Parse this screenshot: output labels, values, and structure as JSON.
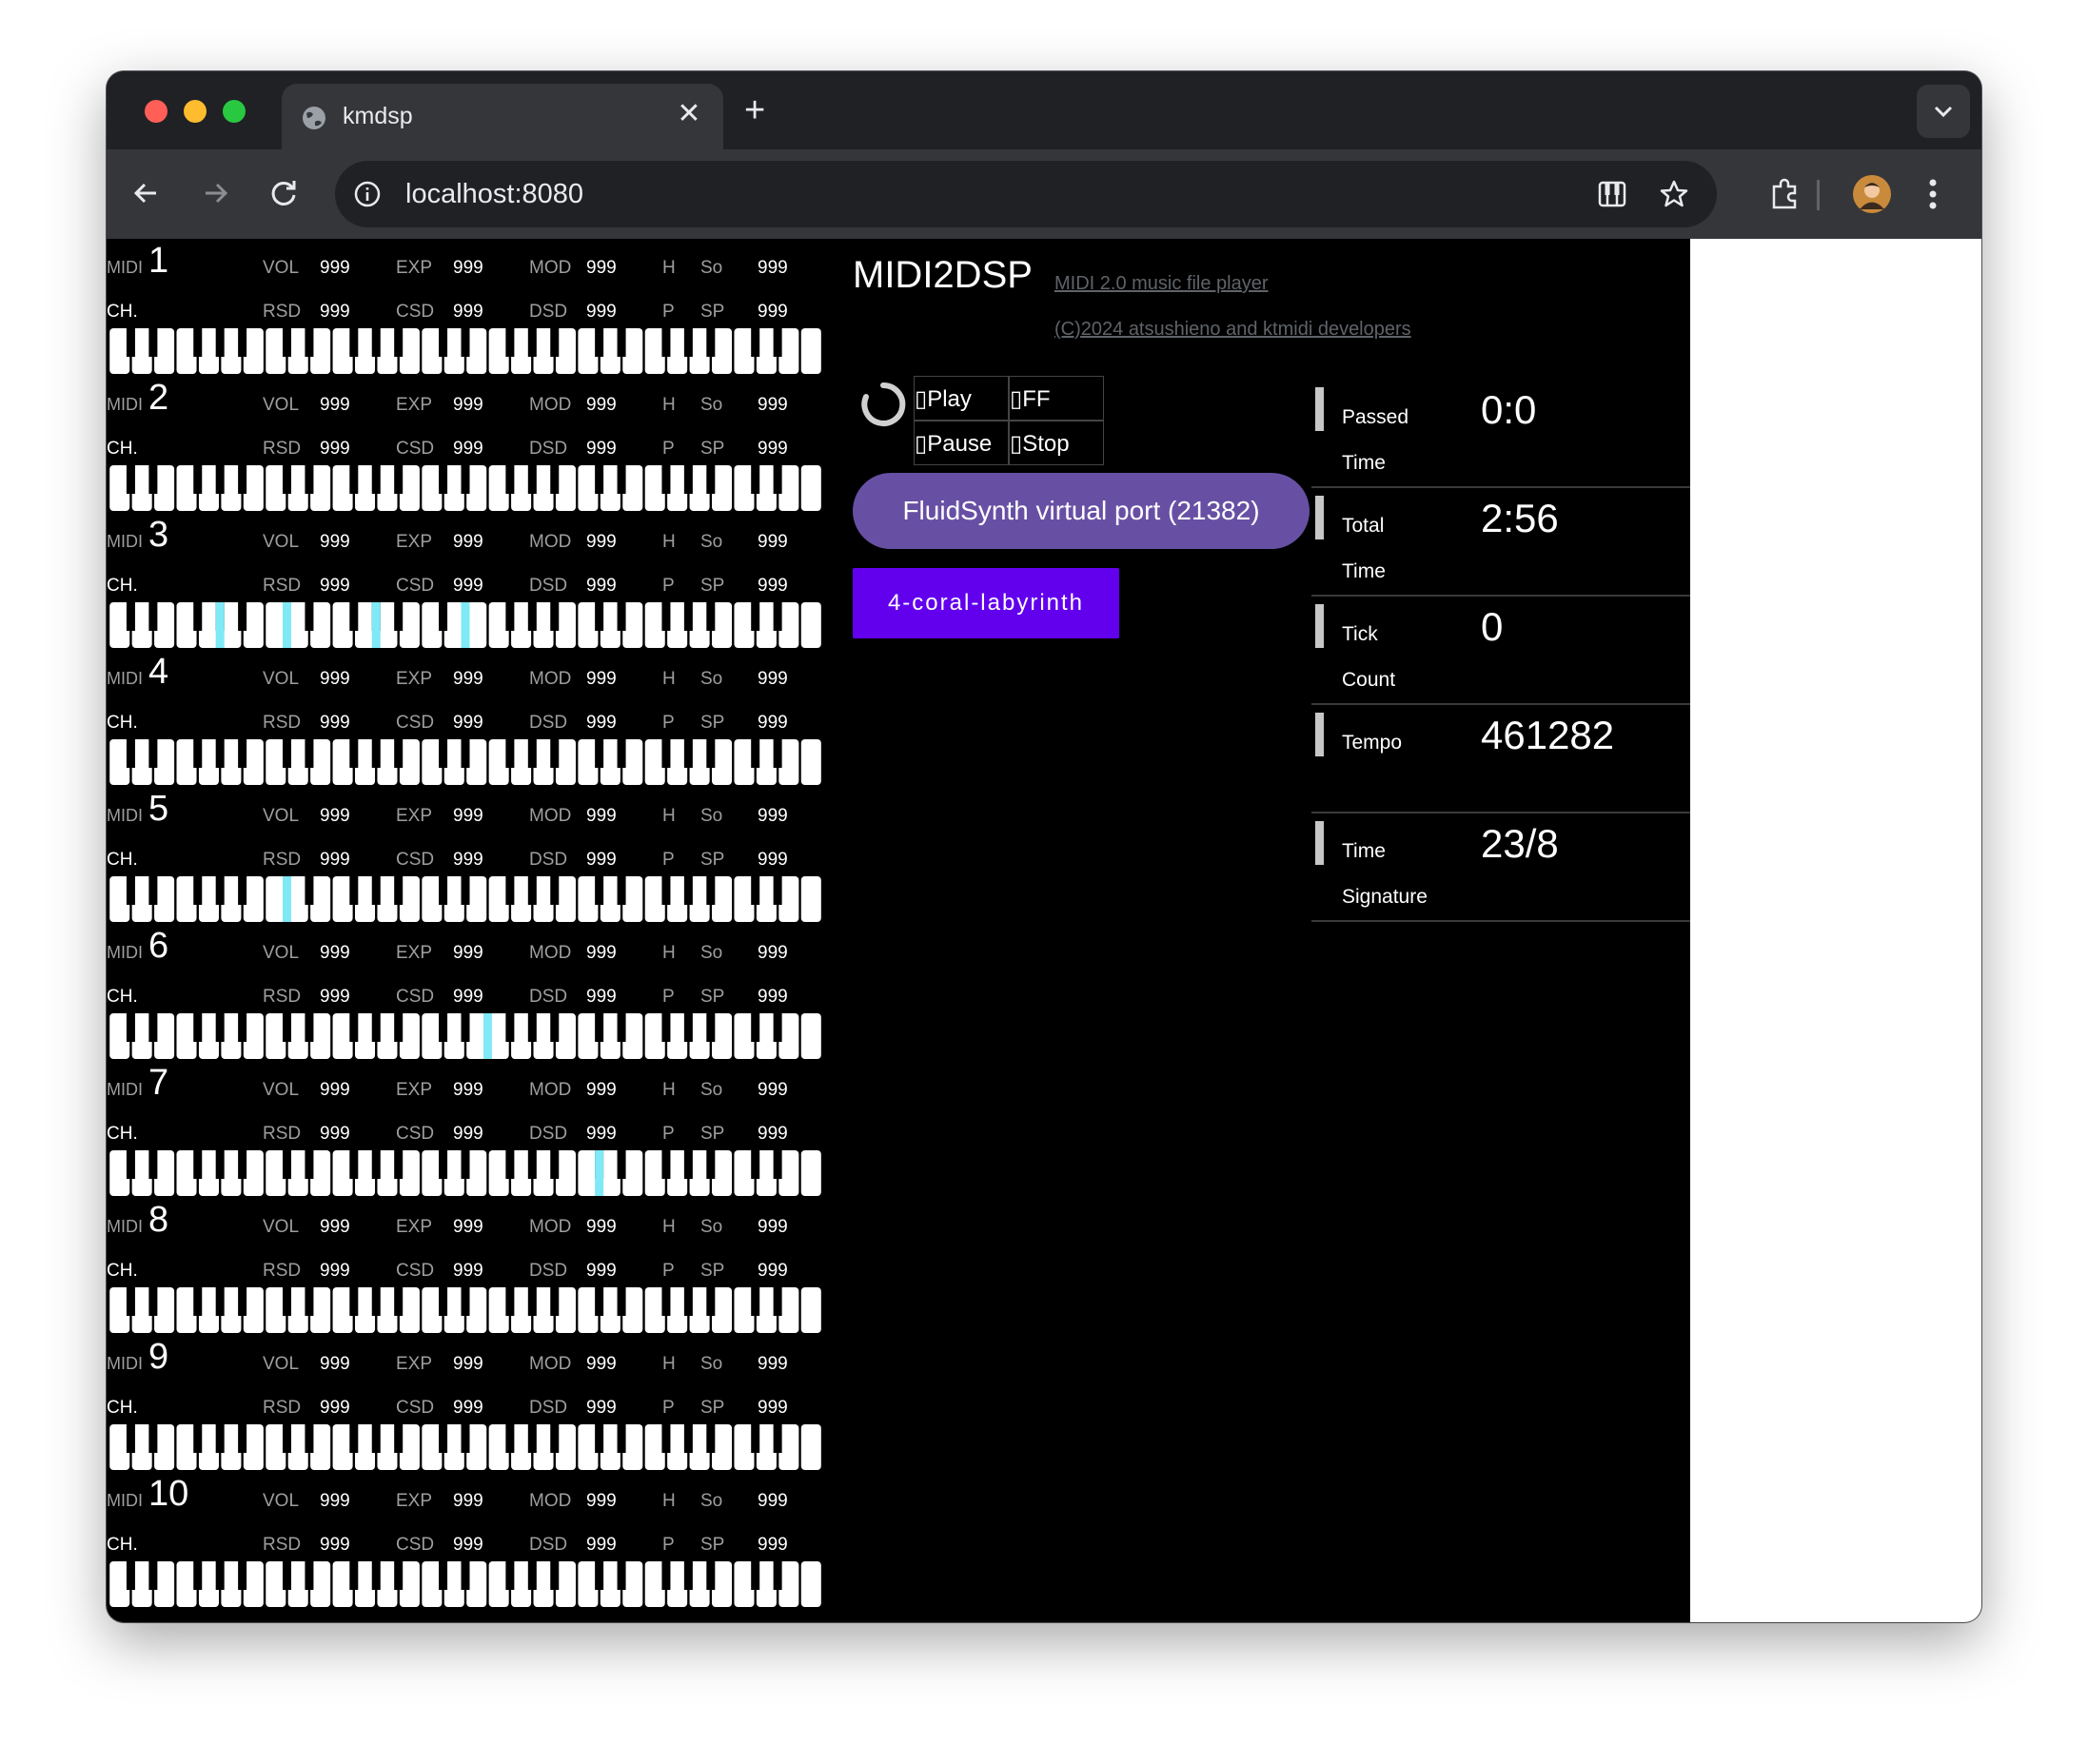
{
  "browser": {
    "tab_title": "kmdsp",
    "tab_close": "✕",
    "new_tab": "+",
    "url": "localhost:8080"
  },
  "app": {
    "title": "MIDI2DSP",
    "subtitle": "MIDI 2.0 music file player",
    "copyright": "(C)2024 atsushieno and ktmidi developers",
    "controls": {
      "play": "▯Play",
      "ff": "▯FF",
      "pause": "▯Pause",
      "stop": "▯Stop"
    },
    "device_button": "FluidSynth virtual port (21382)",
    "song_button": "4-coral-labyrinth",
    "status": [
      {
        "label1": "Passed",
        "label2": "Time",
        "value": "0:0"
      },
      {
        "label1": "Total",
        "label2": "Time",
        "value": "2:56"
      },
      {
        "label1": "Tick",
        "label2": "Count",
        "value": "0"
      },
      {
        "label1": "Tempo",
        "label2": "",
        "value": "461282"
      },
      {
        "label1": "Time",
        "label2": "Signature",
        "value": "23/8"
      }
    ]
  },
  "channel_labels": {
    "midi": "MIDI",
    "ch": "CH.",
    "vol": "VOL",
    "exp": "EXP",
    "mod": "MOD",
    "h": "H",
    "so": "So",
    "rsd": "RSD",
    "csd": "CSD",
    "dsd": "DSD",
    "p": "P",
    "sp": "SP"
  },
  "channels": [
    {
      "number": "1",
      "vol": "999",
      "exp": "999",
      "mod": "999",
      "so": "999",
      "rsd": "999",
      "csd": "999",
      "dsd": "999",
      "sp": "999",
      "active_keys": []
    },
    {
      "number": "2",
      "vol": "999",
      "exp": "999",
      "mod": "999",
      "so": "999",
      "rsd": "999",
      "csd": "999",
      "dsd": "999",
      "sp": "999",
      "active_keys": []
    },
    {
      "number": "3",
      "vol": "999",
      "exp": "999",
      "mod": "999",
      "so": "999",
      "rsd": "999",
      "csd": "999",
      "dsd": "999",
      "sp": "999",
      "active_keys": [
        4,
        7,
        11,
        15
      ]
    },
    {
      "number": "4",
      "vol": "999",
      "exp": "999",
      "mod": "999",
      "so": "999",
      "rsd": "999",
      "csd": "999",
      "dsd": "999",
      "sp": "999",
      "active_keys": []
    },
    {
      "number": "5",
      "vol": "999",
      "exp": "999",
      "mod": "999",
      "so": "999",
      "rsd": "999",
      "csd": "999",
      "dsd": "999",
      "sp": "999",
      "active_keys": [
        7
      ]
    },
    {
      "number": "6",
      "vol": "999",
      "exp": "999",
      "mod": "999",
      "so": "999",
      "rsd": "999",
      "csd": "999",
      "dsd": "999",
      "sp": "999",
      "active_keys": [
        16
      ]
    },
    {
      "number": "7",
      "vol": "999",
      "exp": "999",
      "mod": "999",
      "so": "999",
      "rsd": "999",
      "csd": "999",
      "dsd": "999",
      "sp": "999",
      "active_keys": [
        21
      ]
    },
    {
      "number": "8",
      "vol": "999",
      "exp": "999",
      "mod": "999",
      "so": "999",
      "rsd": "999",
      "csd": "999",
      "dsd": "999",
      "sp": "999",
      "active_keys": []
    },
    {
      "number": "9",
      "vol": "999",
      "exp": "999",
      "mod": "999",
      "so": "999",
      "rsd": "999",
      "csd": "999",
      "dsd": "999",
      "sp": "999",
      "active_keys": []
    },
    {
      "number": "10",
      "vol": "999",
      "exp": "999",
      "mod": "999",
      "so": "999",
      "rsd": "999",
      "csd": "999",
      "dsd": "999",
      "sp": "999",
      "active_keys": []
    }
  ],
  "colors": {
    "active_key": "#7fe9f5",
    "accent_purple": "#6750a4",
    "song_button": "#6200ee"
  }
}
